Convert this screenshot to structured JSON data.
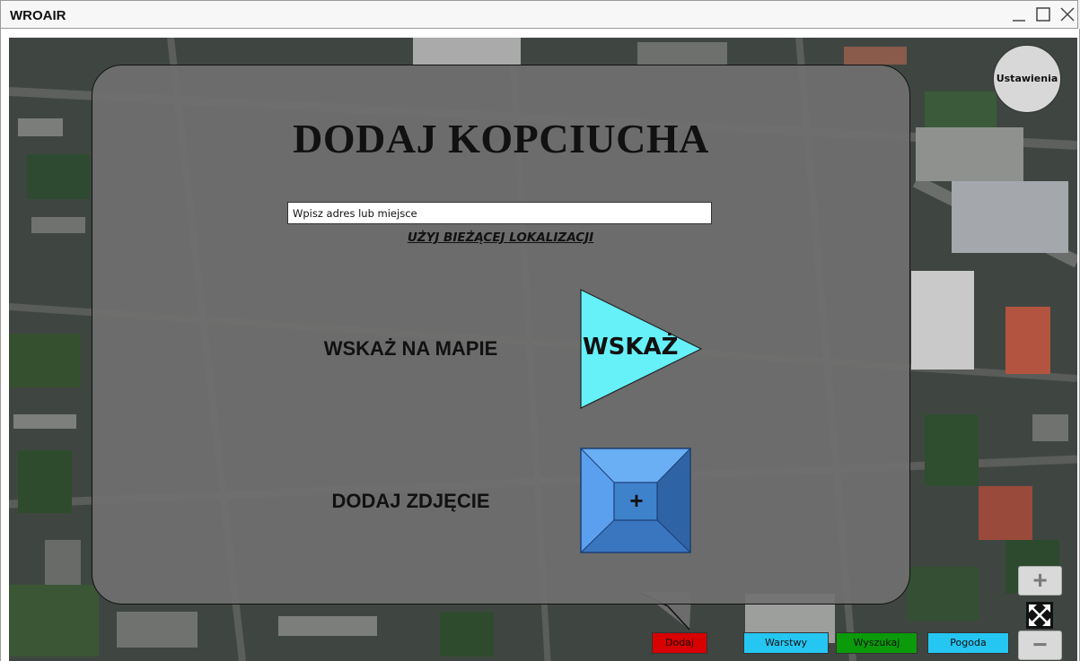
{
  "window": {
    "title": "WROAIR"
  },
  "dialog": {
    "title": "DODAJ KOPCIUCHA",
    "address_placeholder": "Wpisz adres lub miejsce",
    "use_location_label": "UŻYJ BIEŻĄCEJ LOKALIZACJI",
    "point_on_map_label": "WSKAŻ NA MAPIE",
    "point_button_label": "WSKAŻ",
    "add_photo_label": "DODAJ ZDJĘCIE",
    "add_photo_button_symbol": "+"
  },
  "settings_label": "Ustawienia",
  "bottom_nav": [
    {
      "label": "Dodaj",
      "color": "#d90000"
    },
    {
      "label": "Warstwy",
      "color": "#25c6f2"
    },
    {
      "label": "Wyszukaj",
      "color": "#0a9a0a"
    },
    {
      "label": "Pogoda",
      "color": "#25c6f2"
    }
  ],
  "map_controls": {
    "zoom_in": "+",
    "zoom_out": "−"
  },
  "colors": {
    "point_button_fill": "#66f0f8",
    "photo_button_face": "#3f82cc",
    "photo_button_light": "#66aaf2",
    "photo_button_dark": "#2d64a8"
  }
}
